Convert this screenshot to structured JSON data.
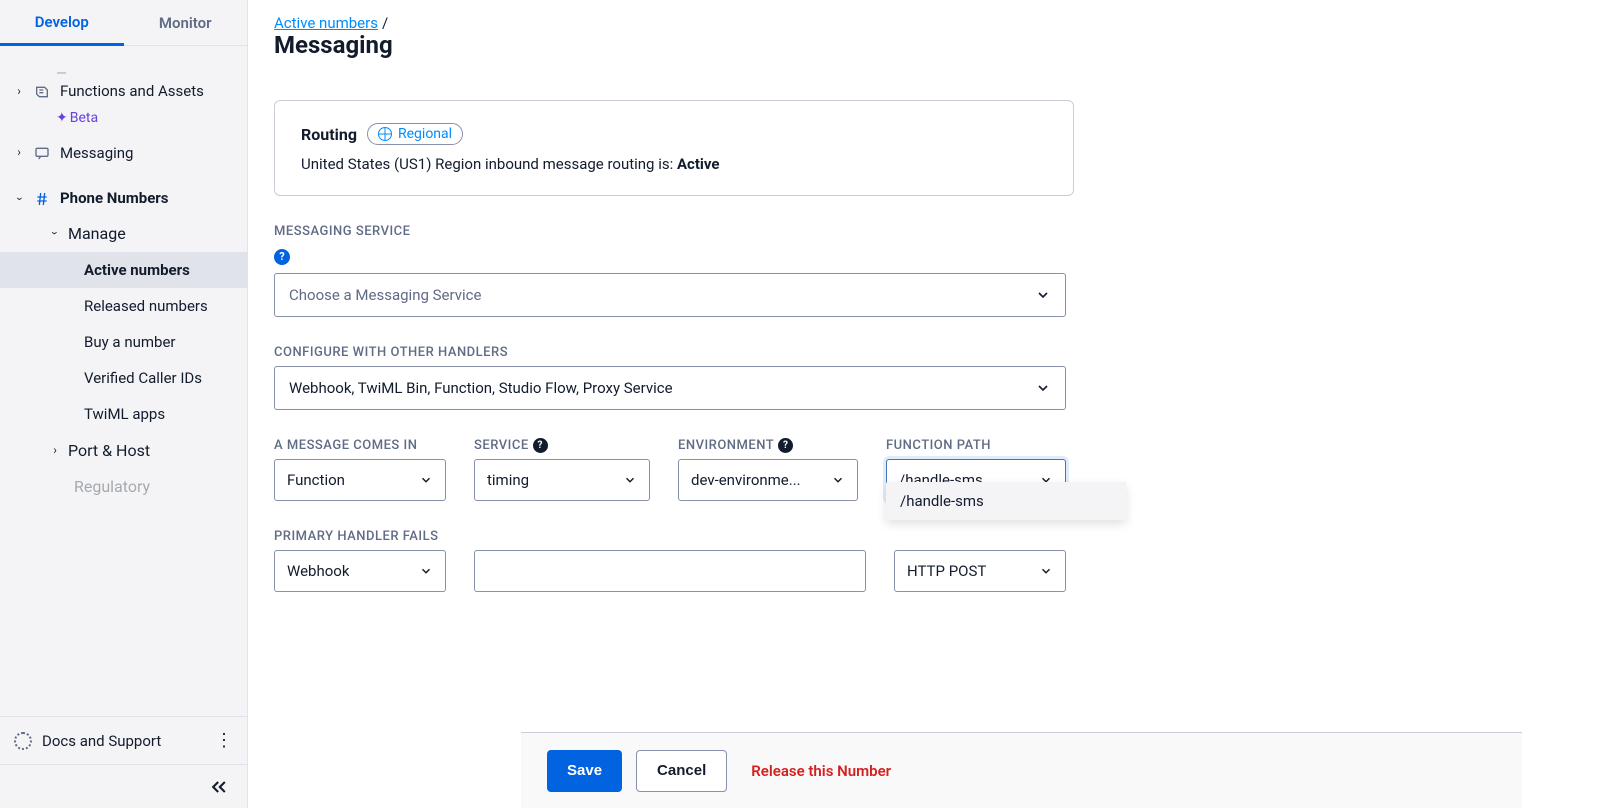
{
  "tabs": {
    "develop": "Develop",
    "monitor": "Monitor"
  },
  "sidebar": {
    "functions_assets": "Functions and Assets",
    "beta": "Beta",
    "messaging_nav": "Messaging",
    "phone_numbers": "Phone Numbers",
    "manage": "Manage",
    "active_numbers": "Active numbers",
    "released_numbers": "Released numbers",
    "buy_a_number": "Buy a number",
    "verified_caller_ids": "Verified Caller IDs",
    "twiml_apps": "TwiML apps",
    "port_host": "Port & Host",
    "regulatory": "Regulatory",
    "docs_support": "Docs and Support"
  },
  "breadcrumb": {
    "link": "Active numbers",
    "slash": "/"
  },
  "heading": "Messaging",
  "card": {
    "routing_label": "Routing",
    "regional": "Regional",
    "text_before": "United States (US1) Region inbound message routing is: ",
    "status": "Active"
  },
  "labels": {
    "messaging_service": "MESSAGING SERVICE",
    "messaging_service_placeholder": "Choose a Messaging Service",
    "configure_handlers": "CONFIGURE WITH OTHER HANDLERS",
    "handlers_value": "Webhook, TwiML Bin, Function, Studio Flow, Proxy Service",
    "message_comes_in": "A MESSAGE COMES IN",
    "service": "SERVICE",
    "environment": "ENVIRONMENT",
    "function_path": "FUNCTION PATH",
    "primary_fails": "PRIMARY HANDLER FAILS"
  },
  "values": {
    "message_comes_in": "Function",
    "service": "timing",
    "environment": "dev-environme...",
    "function_path": "/handle-sms",
    "dropdown_option": "/handle-sms",
    "primary_fails": "Webhook",
    "http_method": "HTTP POST"
  },
  "footer": {
    "save": "Save",
    "cancel": "Cancel",
    "release": "Release this Number"
  }
}
